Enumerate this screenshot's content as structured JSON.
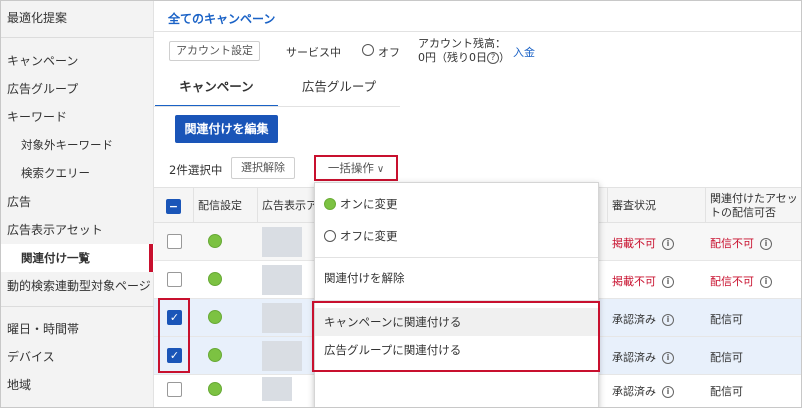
{
  "sidebar": {
    "items": [
      {
        "label": "最適化提案"
      },
      {
        "label": "キャンペーン"
      },
      {
        "label": "広告グループ"
      },
      {
        "label": "キーワード"
      },
      {
        "label": "対象外キーワード"
      },
      {
        "label": "検索クエリー"
      },
      {
        "label": "広告"
      },
      {
        "label": "広告表示アセット"
      },
      {
        "label": "関連付け一覧"
      },
      {
        "label": "動的検索連動型対象ページ"
      },
      {
        "label": "曜日・時間帯"
      },
      {
        "label": "デバイス"
      },
      {
        "label": "地域"
      }
    ]
  },
  "header": {
    "title": "全てのキャンペーン",
    "account_settings": "アカウント設定",
    "service_status": "サービス中",
    "off_label": "オフ",
    "balance_label": "アカウント残高：",
    "balance_value": "0円（残り0日",
    "help_glyph": "?",
    "balance_close": "）",
    "deposit": "入金"
  },
  "tabs": [
    {
      "label": "キャンペーン"
    },
    {
      "label": "広告グループ"
    }
  ],
  "toolbar": {
    "edit_associations": "関連付けを編集",
    "selected_count": "2件選択中",
    "deselect": "選択解除",
    "bulk_actions": "一括操作",
    "chevron": "∨"
  },
  "table": {
    "headers": [
      "配信設定",
      "広告表示ア",
      "審査状況",
      "関連付けたアセットの配信可否"
    ],
    "rows": [
      {
        "checked": false,
        "review": "掲載不可",
        "delivery": "配信不可",
        "status_color": "red"
      },
      {
        "checked": false,
        "review": "掲載不可",
        "delivery": "配信不可",
        "status_color": "red"
      },
      {
        "checked": true,
        "review": "承認済み",
        "delivery": "配信可",
        "status_color": "normal"
      },
      {
        "checked": true,
        "review": "承認済み",
        "delivery": "配信可",
        "status_color": "normal"
      },
      {
        "checked": false,
        "review": "承認済み",
        "delivery": "配信可",
        "status_color": "normal"
      }
    ],
    "info_glyph": "i",
    "check_glyph": "✓",
    "minus_glyph": "−"
  },
  "dropdown": {
    "items": [
      {
        "label": "オンに変更"
      },
      {
        "label": "オフに変更"
      },
      {
        "label": "関連付けを解除"
      },
      {
        "label": "キャンペーンに関連付ける"
      },
      {
        "label": "広告グループに関連付ける"
      }
    ]
  },
  "colors": {
    "accent": "#1a55b8",
    "link": "#1a62c6",
    "error": "#c8102e",
    "on_green": "#7cc242"
  }
}
